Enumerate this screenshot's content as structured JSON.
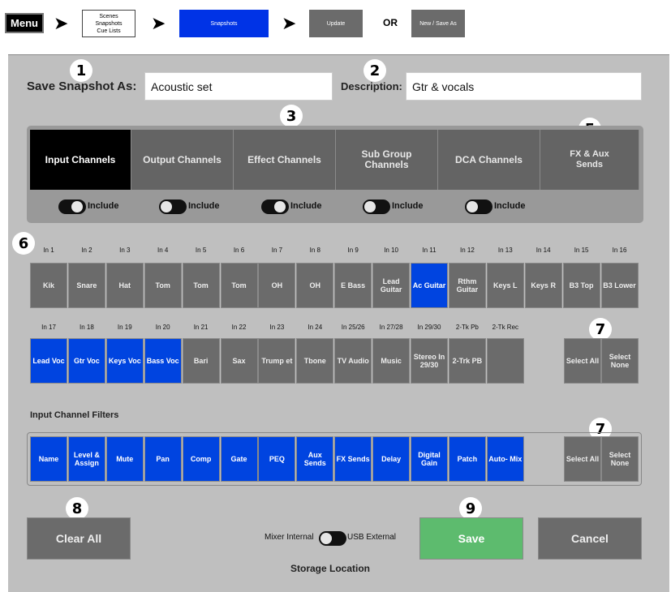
{
  "breadcrumb": {
    "menu": "Menu",
    "scenes_box": [
      "Scenes",
      "Snapshots",
      "Cue Lists"
    ],
    "snapshots": "Snapshots",
    "update": "Update",
    "or": "OR",
    "new_save_as": "New / Save As"
  },
  "form": {
    "save_as_label": "Save Snapshot As:",
    "save_as_value": "Acoustic set",
    "description_label": "Description:",
    "description_value": "Gtr & vocals"
  },
  "markers": [
    "1",
    "2",
    "3",
    "4",
    "5",
    "6",
    "7",
    "7",
    "8",
    "9"
  ],
  "tabs": [
    {
      "label": "Input Channels",
      "active": true
    },
    {
      "label": "Output Channels",
      "active": false
    },
    {
      "label": "Effect Channels",
      "active": false
    },
    {
      "label": "Sub Group Channels",
      "active": false
    },
    {
      "label": "DCA Channels",
      "active": false
    },
    {
      "label": "FX & Aux Sends",
      "active": false
    }
  ],
  "include_label": "Include",
  "include_toggles": [
    true,
    false,
    true,
    false,
    false
  ],
  "channels_row1": {
    "labels": [
      "In 1",
      "In 2",
      "In 3",
      "In 4",
      "In 5",
      "In 6",
      "In 7",
      "In 8",
      "In 9",
      "In 10",
      "In 11",
      "In 12",
      "In 13",
      "In 14",
      "In 15",
      "In 16"
    ],
    "names": [
      "Kik",
      "Snare",
      "Hat",
      "Tom",
      "Tom",
      "Tom",
      "OH",
      "OH",
      "E Bass",
      "Lead Guitar",
      "Ac Guitar",
      "Rthm Guitar",
      "Keys L",
      "Keys R",
      "B3 Top",
      "B3 Lower"
    ],
    "selected": [
      false,
      false,
      false,
      false,
      false,
      false,
      false,
      false,
      false,
      false,
      true,
      false,
      false,
      false,
      false,
      false
    ]
  },
  "channels_row2": {
    "labels": [
      "In 17",
      "In 18",
      "In 19",
      "In 20",
      "In 21",
      "In 22",
      "In 23",
      "In 24",
      "In 25/26",
      "In 27/28",
      "In 29/30",
      "2-Tk Pb",
      "2-Tk Rec"
    ],
    "names": [
      "Lead Voc",
      "Gtr Voc",
      "Keys Voc",
      "Bass Voc",
      "Bari",
      "Sax",
      "Trump et",
      "Tbone",
      "TV Audio",
      "Music",
      "Stereo In 29/30",
      "2-Trk PB",
      ""
    ],
    "selected": [
      true,
      true,
      true,
      true,
      false,
      false,
      false,
      false,
      false,
      false,
      false,
      false,
      false
    ]
  },
  "select_all": "Select All",
  "select_none": "Select None",
  "filters_heading": "Input Channel Filters",
  "filters": [
    "Name",
    "Level & Assign",
    "Mute",
    "Pan",
    "Comp",
    "Gate",
    "PEQ",
    "Aux Sends",
    "FX Sends",
    "Delay",
    "Digital Gain",
    "Patch",
    "Auto- Mix"
  ],
  "bottom": {
    "clear_all": "Clear All",
    "mixer_internal": "Mixer Internal",
    "usb_external": "USB External",
    "storage_location": "Storage Location",
    "save": "Save",
    "cancel": "Cancel"
  },
  "colors": {
    "accent_blue": "#0044e0",
    "save_green": "#5dbb6e",
    "panel_gray": "#bfbfbf",
    "button_gray": "#6b6b6b"
  }
}
